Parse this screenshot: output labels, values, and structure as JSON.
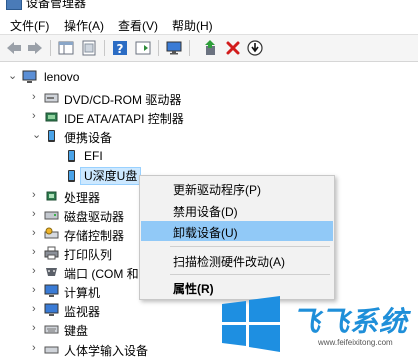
{
  "window": {
    "title": "设备管理器"
  },
  "menubar": {
    "items": [
      {
        "label": "文件(F)"
      },
      {
        "label": "操作(A)"
      },
      {
        "label": "查看(V)"
      },
      {
        "label": "帮助(H)"
      }
    ]
  },
  "toolbar": {
    "buttons": [
      {
        "icon": "back-arrow-icon"
      },
      {
        "icon": "forward-arrow-icon"
      },
      {
        "icon": "show-hide-tree-icon"
      },
      {
        "icon": "properties-icon"
      },
      {
        "icon": "help-icon"
      },
      {
        "icon": "action-pane-icon"
      },
      {
        "icon": "monitor-icon"
      },
      {
        "icon": "update-driver-icon"
      },
      {
        "icon": "uninstall-x-icon"
      },
      {
        "icon": "download-circle-icon"
      }
    ]
  },
  "tree": {
    "root": {
      "label": "lenovo",
      "icon": "computer-icon",
      "expanded": true
    },
    "items": [
      {
        "label": "DVD/CD-ROM 驱动器",
        "icon": "dvd-drive-icon",
        "expanded": false
      },
      {
        "label": "IDE ATA/ATAPI 控制器",
        "icon": "ide-controller-icon",
        "expanded": false
      },
      {
        "label": "便携设备",
        "icon": "portable-device-icon",
        "expanded": true
      },
      {
        "label": "EFI",
        "icon": "phone-device-icon",
        "child": true
      },
      {
        "label": "U深度U盘",
        "icon": "phone-device-icon",
        "child": true,
        "selected": true
      },
      {
        "label": "处理器",
        "icon": "processor-icon",
        "expanded": false
      },
      {
        "label": "磁盘驱动器",
        "icon": "disk-drive-icon",
        "expanded": false
      },
      {
        "label": "存储控制器",
        "icon": "storage-controller-icon",
        "expanded": false
      },
      {
        "label": "打印队列",
        "icon": "printer-icon",
        "expanded": false
      },
      {
        "label": "端口 (COM 和",
        "icon": "port-icon",
        "expanded": false
      },
      {
        "label": "计算机",
        "icon": "monitor-icon",
        "expanded": false
      },
      {
        "label": "监视器",
        "icon": "monitor-icon",
        "expanded": false
      },
      {
        "label": "键盘",
        "icon": "keyboard-icon",
        "expanded": false
      },
      {
        "label": "人体学输入设备",
        "icon": "hid-icon",
        "expanded": false
      }
    ]
  },
  "context_menu": {
    "items": [
      {
        "label": "更新驱动程序(P)"
      },
      {
        "label": "禁用设备(D)"
      },
      {
        "label": "卸载设备(U)",
        "highlighted": true
      },
      {
        "label": "扫描检测硬件改动(A)"
      },
      {
        "label": "属性(R)",
        "bold": true
      }
    ]
  },
  "watermark": {
    "brand": "飞飞系统",
    "site": "www.feifeixitong.com"
  },
  "colors": {
    "selection_bg": "#cce8ff",
    "menu_highlight": "#91c9f7",
    "brand_blue": "#1f8fd9",
    "uninstall_red": "#d21c1c"
  }
}
